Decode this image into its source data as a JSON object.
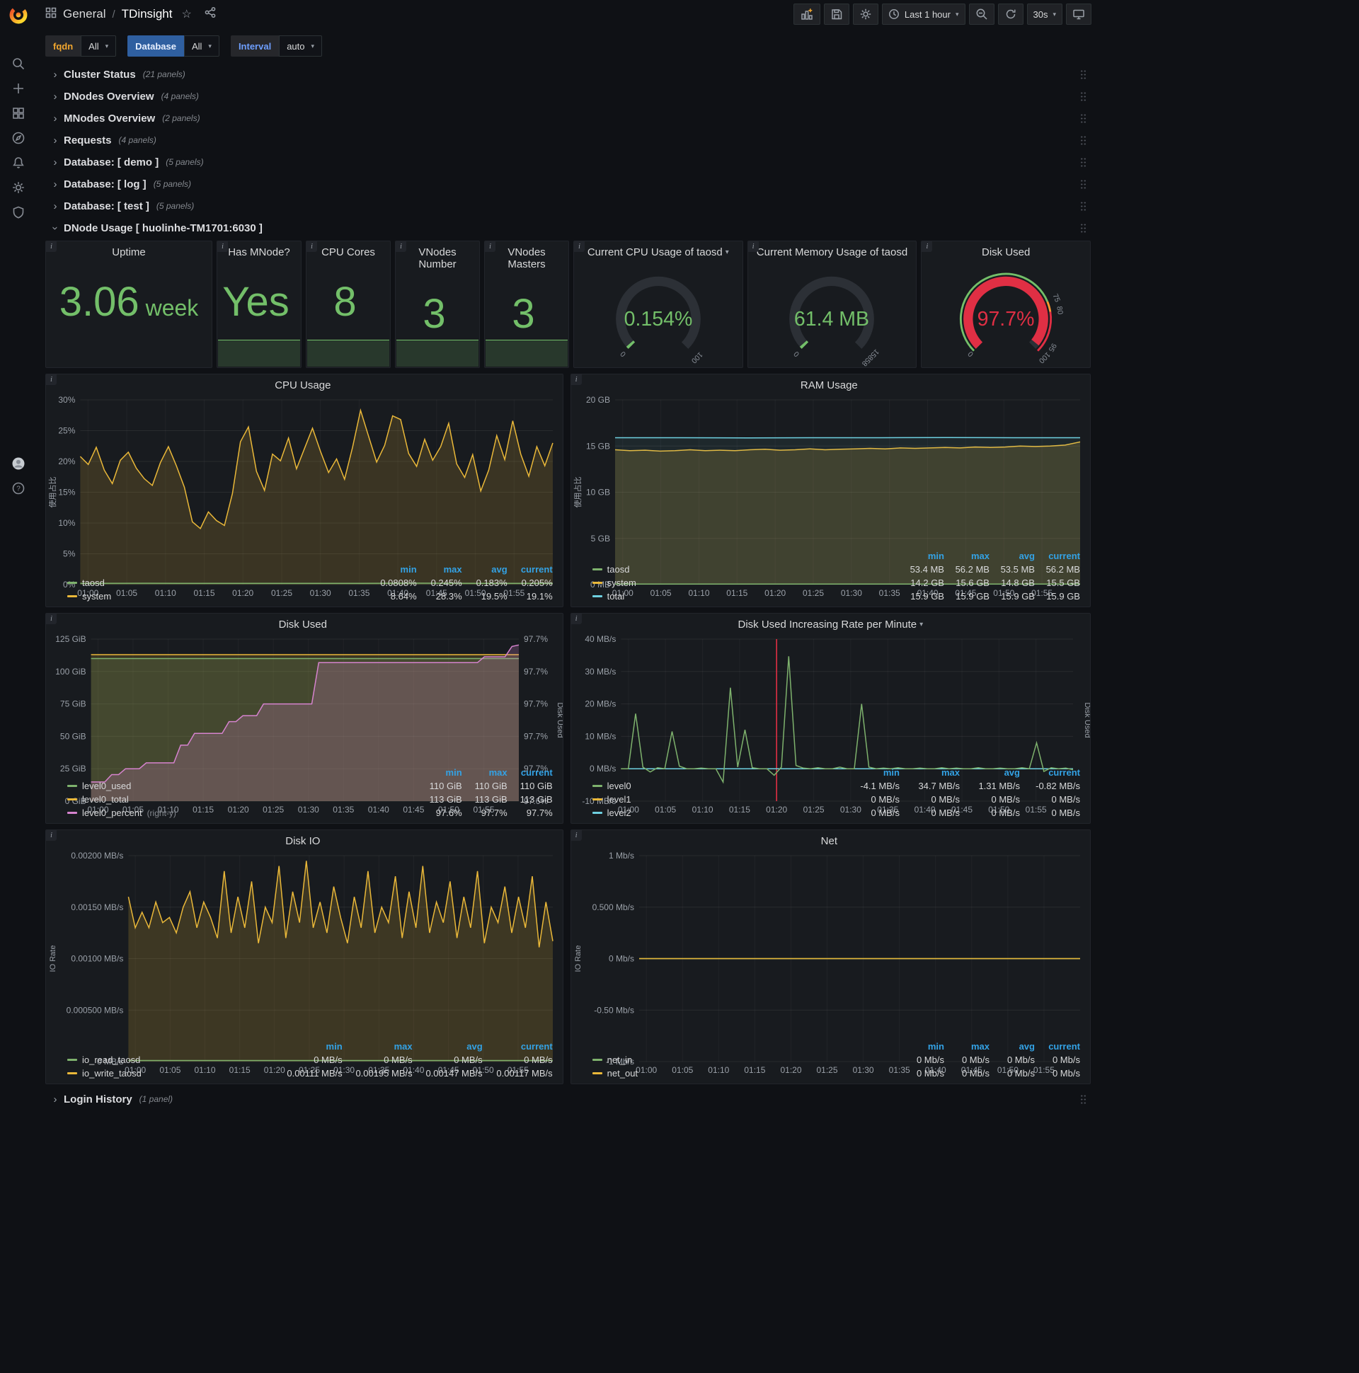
{
  "nav": {
    "section": "General",
    "separator": "/",
    "title": "TDinsight",
    "time_range": "Last 1 hour",
    "refresh": "30s"
  },
  "variables": [
    {
      "label": "fqdn",
      "value": "All",
      "label_color": "#f3a72e",
      "label_bg": "#26272b"
    },
    {
      "label": "Database",
      "value": "All",
      "label_color": "#e8f0ff",
      "label_bg": "#2f5fa0"
    },
    {
      "label": "Interval",
      "value": "auto",
      "label_color": "#6e9fff",
      "label_bg": "#26272b"
    }
  ],
  "rows_top": [
    {
      "title": "Cluster Status",
      "count": "(21 panels)"
    },
    {
      "title": "DNodes Overview",
      "count": "(4 panels)"
    },
    {
      "title": "MNodes Overview",
      "count": "(2 panels)"
    },
    {
      "title": "Requests",
      "count": "(4 panels)"
    },
    {
      "title": "Database: [ demo ]",
      "count": "(5 panels)"
    },
    {
      "title": "Database: [ log ]",
      "count": "(5 panels)"
    },
    {
      "title": "Database: [ test ]",
      "count": "(5 panels)"
    }
  ],
  "expanded_row": {
    "title": "DNode Usage [ huolinhe-TM1701:6030 ]"
  },
  "bottom_row": {
    "title": "Login History",
    "count": "(1 panel)"
  },
  "stats": [
    {
      "title": "Uptime",
      "value": "3.06",
      "unit": "week",
      "sparkline": false
    },
    {
      "title": "Has MNode?",
      "value": "Yes",
      "unit": "",
      "sparkline": true
    },
    {
      "title": "CPU Cores",
      "value": "8",
      "unit": "",
      "sparkline": true
    },
    {
      "title": "VNodes Number",
      "value": "3",
      "unit": "",
      "sparkline": true
    },
    {
      "title": "VNodes Masters",
      "value": "3",
      "unit": "",
      "sparkline": true
    }
  ],
  "gauges": [
    {
      "title": "Current CPU Usage of taosd",
      "menu_caret": "▾",
      "value": "0.154%",
      "min_label": "0",
      "max_label": "100",
      "fraction": 0.00154,
      "value_color": "#73bf69",
      "arc_color": "#73bf69",
      "thresholds": [],
      "ring": []
    },
    {
      "title": "Current Memory Usage of taosd",
      "menu_caret": "",
      "value": "61.4 MB",
      "min_label": "0",
      "max_label": "15858",
      "fraction": 0.004,
      "value_color": "#73bf69",
      "arc_color": "#73bf69",
      "thresholds": [],
      "ring": []
    },
    {
      "title": "Disk Used",
      "menu_caret": "",
      "value": "97.7%",
      "min_label": "0",
      "max_label": "100",
      "fraction": 0.977,
      "value_color": "#e02f44",
      "arc_color": "#e02f44",
      "thresholds": [
        {
          "frac": 0.75,
          "label": "75"
        },
        {
          "frac": 0.8,
          "label": "80"
        },
        {
          "frac": 0.95,
          "label": "95"
        }
      ],
      "ring": [
        {
          "from": 0,
          "to": 0.75,
          "color": "#73bf69"
        },
        {
          "from": 0.75,
          "to": 0.8,
          "color": "#ff9830"
        },
        {
          "from": 0.8,
          "to": 1,
          "color": "#e02f44"
        }
      ]
    }
  ],
  "charts": [
    {
      "title": "CPU Usage",
      "menu_caret": "",
      "type": "line",
      "y_label": "使用占比",
      "y_ticks": [
        "30%",
        "25%",
        "20%",
        "15%",
        "10%",
        "5%",
        "0%"
      ],
      "y_range": [
        0,
        30
      ],
      "x_ticks": [
        "01:00",
        "01:05",
        "01:10",
        "01:15",
        "01:20",
        "01:25",
        "01:30",
        "01:35",
        "01:40",
        "01:45",
        "01:50",
        "01:55"
      ],
      "x_range": [
        -1,
        60
      ],
      "series": [
        {
          "name": "system",
          "color": "#eab839",
          "fill": 0.16,
          "values": [
            20.8,
            19.5,
            22.3,
            18.6,
            16.4,
            20.2,
            21.5,
            18.9,
            17.2,
            16.1,
            19.8,
            22.4,
            19.3,
            15.8,
            10.2,
            9.1,
            11.8,
            10.4,
            9.6,
            14.8,
            23.2,
            25.6,
            18.4,
            15.3,
            21.2,
            20.1,
            23.8,
            18.8,
            22.1,
            25.4,
            21.6,
            18.2,
            20.4,
            17.1,
            22.3,
            28.3,
            24.1,
            19.9,
            22.6,
            27.4,
            26.8,
            21.3,
            19.2,
            23.6,
            20.2,
            22.4,
            26.2,
            19.6,
            17.4,
            21.1,
            15.2,
            18.6,
            24.2,
            20.3,
            26.6,
            21.2,
            17.6,
            22.4,
            19.3,
            23.0
          ]
        },
        {
          "name": "taosd",
          "color": "#7eb26d",
          "fill": 0.12,
          "values": [
            0.2,
            0.22,
            0.19,
            0.21,
            0.2,
            0.23,
            0.2,
            0.21
          ]
        }
      ],
      "legend": {
        "cols": [
          "min",
          "max",
          "avg",
          "current"
        ],
        "rows": [
          {
            "name": "taosd",
            "color": "#7eb26d",
            "values": [
              "0.0808%",
              "0.245%",
              "0.183%",
              "0.205%"
            ]
          },
          {
            "name": "system",
            "color": "#eab839",
            "values": [
              "8.64%",
              "28.3%",
              "19.5%",
              "19.1%"
            ]
          }
        ]
      }
    },
    {
      "title": "RAM Usage",
      "menu_caret": "",
      "type": "line",
      "y_label": "使用占比",
      "y_ticks": [
        "20 GB",
        "15 GB",
        "10 GB",
        "5 GB",
        "0 MB"
      ],
      "y_range": [
        0,
        20
      ],
      "x_ticks": [
        "01:00",
        "01:05",
        "01:10",
        "01:15",
        "01:20",
        "01:25",
        "01:30",
        "01:35",
        "01:40",
        "01:45",
        "01:50",
        "01:55"
      ],
      "x_range": [
        -1,
        60
      ],
      "series": [
        {
          "name": "system",
          "color": "#eab839",
          "fill": 0.18,
          "values": [
            14.6,
            14.5,
            14.55,
            14.45,
            14.5,
            14.6,
            14.5,
            14.55,
            14.5,
            14.6,
            14.65,
            14.55,
            14.6,
            14.7,
            14.6,
            14.65,
            14.7,
            14.75,
            14.7,
            14.8,
            14.75,
            14.8,
            14.85,
            14.8,
            14.9,
            14.85,
            14.9,
            15.0,
            14.95,
            15.0,
            15.1,
            15.45
          ]
        },
        {
          "name": "total",
          "color": "#6ed0e0",
          "fill": 0.07,
          "values": [
            15.9,
            15.9,
            15.88,
            15.9,
            15.9,
            15.92,
            15.9,
            15.9
          ]
        },
        {
          "name": "taosd",
          "color": "#7eb26d",
          "fill": 0.1,
          "values": [
            0.052,
            0.052
          ]
        }
      ],
      "legend": {
        "cols": [
          "min",
          "max",
          "avg",
          "current"
        ],
        "rows": [
          {
            "name": "taosd",
            "color": "#7eb26d",
            "values": [
              "53.4 MB",
              "56.2 MB",
              "53.5 MB",
              "56.2 MB"
            ]
          },
          {
            "name": "system",
            "color": "#eab839",
            "values": [
              "14.2 GB",
              "15.6 GB",
              "14.8 GB",
              "15.5 GB"
            ]
          },
          {
            "name": "total",
            "color": "#6ed0e0",
            "values": [
              "15.9 GB",
              "15.9 GB",
              "15.9 GB",
              "15.9 GB"
            ]
          }
        ]
      }
    },
    {
      "title": "Disk Used",
      "menu_caret": "",
      "type": "line",
      "y_ticks": [
        "125 GiB",
        "100 GiB",
        "75 GiB",
        "50 GiB",
        "25 GiB",
        "0 GiB"
      ],
      "y_range": [
        0,
        125
      ],
      "y2_ticks": [
        "97.7%",
        "97.7%",
        "97.7%",
        "97.7%",
        "97.7%",
        "97.6%"
      ],
      "y2_range": [
        97.595,
        97.705
      ],
      "y2_label": "Disk Used",
      "x_ticks": [
        "01:00",
        "01:05",
        "01:10",
        "01:15",
        "01:20",
        "01:25",
        "01:30",
        "01:35",
        "01:40",
        "01:45",
        "01:50",
        "01:55"
      ],
      "x_range": [
        -1,
        60
      ],
      "series": [
        {
          "name": "level0_total",
          "color": "#eab839",
          "fill": 0.16,
          "values": [
            113,
            113
          ]
        },
        {
          "name": "level0_used",
          "color": "#7eb26d",
          "fill": 0.16,
          "values": [
            110,
            110
          ]
        },
        {
          "name": "level0_percent",
          "color": "#d683ce",
          "fill": 0.22,
          "y2": true,
          "values": [
            97.608,
            97.608,
            97.608,
            97.613,
            97.613,
            97.617,
            97.617,
            97.617,
            97.621,
            97.621,
            97.621,
            97.621,
            97.621,
            97.633,
            97.633,
            97.641,
            97.641,
            97.641,
            97.641,
            97.641,
            97.649,
            97.649,
            97.653,
            97.653,
            97.653,
            97.661,
            97.661,
            97.661,
            97.661,
            97.661,
            97.661,
            97.661,
            97.661,
            97.689,
            97.689,
            97.689,
            97.689,
            97.689,
            97.689,
            97.689,
            97.689,
            97.689,
            97.689,
            97.689,
            97.689,
            97.689,
            97.689,
            97.689,
            97.689,
            97.689,
            97.689,
            97.689,
            97.689,
            97.689,
            97.689,
            97.689,
            97.689,
            97.693,
            97.693,
            97.693,
            97.693,
            97.7,
            97.701
          ]
        }
      ],
      "legend": {
        "cols": [
          "min",
          "max",
          "current"
        ],
        "rows": [
          {
            "name": "level0_used",
            "color": "#7eb26d",
            "values": [
              "110 GiB",
              "110 GiB",
              "110 GiB"
            ]
          },
          {
            "name": "level0_total",
            "color": "#eab839",
            "values": [
              "113 GiB",
              "113 GiB",
              "113 GiB"
            ]
          },
          {
            "name": "level0_percent",
            "suffix": "(right-y)",
            "color": "#d683ce",
            "values": [
              "97.6%",
              "97.7%",
              "97.7%"
            ]
          }
        ]
      }
    },
    {
      "title": "Disk Used Increasing Rate per Minute",
      "menu_caret": "▾",
      "type": "line",
      "y_ticks": [
        "40 MB/s",
        "30 MB/s",
        "20 MB/s",
        "10 MB/s",
        "0 MB/s",
        "-10 MB/s"
      ],
      "y_range": [
        -10,
        40
      ],
      "y2_label": "Disk Used",
      "x_ticks": [
        "01:00",
        "01:05",
        "01:10",
        "01:15",
        "01:20",
        "01:25",
        "01:30",
        "01:35",
        "01:40",
        "01:45",
        "01:50",
        "01:55"
      ],
      "x_range": [
        -1,
        60
      ],
      "annotation": {
        "x": 20,
        "color": "#e02f44"
      },
      "series": [
        {
          "name": "level1",
          "color": "#eab839",
          "fill": 0,
          "values": [
            0,
            0
          ]
        },
        {
          "name": "level2",
          "color": "#6ed0e0",
          "fill": 0,
          "values": [
            0,
            0
          ]
        },
        {
          "name": "level0",
          "color": "#7eb26d",
          "fill": 0,
          "values": [
            0,
            0,
            17,
            0.5,
            -1,
            0.3,
            0,
            11.5,
            0.8,
            0,
            0,
            0.2,
            0,
            0,
            -4.1,
            25,
            0.5,
            12,
            0.3,
            0,
            0,
            -2,
            0.5,
            34.7,
            1,
            0.2,
            0,
            0.3,
            0,
            0,
            0.5,
            0,
            0,
            20,
            0.5,
            0,
            0.2,
            0,
            0.3,
            0,
            0,
            0.2,
            0,
            0,
            0.3,
            0,
            0.2,
            0,
            0,
            0.3,
            0,
            0,
            0.2,
            0,
            0,
            0.3,
            0,
            8,
            -0.82,
            0.3,
            0,
            0.2,
            -0.3
          ]
        }
      ],
      "legend": {
        "cols": [
          "min",
          "max",
          "avg",
          "current"
        ],
        "rows": [
          {
            "name": "level0",
            "color": "#7eb26d",
            "values": [
              "-4.1 MB/s",
              "34.7 MB/s",
              "1.31 MB/s",
              "-0.82 MB/s"
            ]
          },
          {
            "name": "level1",
            "color": "#eab839",
            "values": [
              "0 MB/s",
              "0 MB/s",
              "0 MB/s",
              "0 MB/s"
            ]
          },
          {
            "name": "level2",
            "color": "#6ed0e0",
            "values": [
              "0 MB/s",
              "0 MB/s",
              "0 MB/s",
              "0 MB/s"
            ]
          }
        ]
      }
    },
    {
      "title": "Disk IO",
      "menu_caret": "",
      "type": "line",
      "y_label": "IO Rate",
      "y_ticks": [
        "0.00200 MB/s",
        "0.00150 MB/s",
        "0.00100 MB/s",
        "0.000500 MB/s",
        "0 MB/s"
      ],
      "y_range": [
        0,
        0.002
      ],
      "x_ticks": [
        "01:00",
        "01:05",
        "01:10",
        "01:15",
        "01:20",
        "01:25",
        "01:30",
        "01:35",
        "01:40",
        "01:45",
        "01:50",
        "01:55"
      ],
      "x_range": [
        -1,
        60
      ],
      "series": [
        {
          "name": "io_write_taosd",
          "color": "#eab839",
          "fill": 0.18,
          "values": [
            0.0016,
            0.0013,
            0.00145,
            0.0013,
            0.00155,
            0.00135,
            0.0014,
            0.00125,
            0.0015,
            0.00165,
            0.0013,
            0.00155,
            0.0014,
            0.0012,
            0.00185,
            0.00125,
            0.0016,
            0.0013,
            0.00175,
            0.00115,
            0.0015,
            0.00135,
            0.0019,
            0.0012,
            0.00165,
            0.00135,
            0.00195,
            0.0013,
            0.00155,
            0.00125,
            0.0017,
            0.0014,
            0.00115,
            0.0016,
            0.0013,
            0.00185,
            0.00125,
            0.0015,
            0.00135,
            0.0018,
            0.0012,
            0.00165,
            0.0013,
            0.0019,
            0.00125,
            0.00155,
            0.00135,
            0.00175,
            0.0012,
            0.0016,
            0.0013,
            0.00185,
            0.00115,
            0.0015,
            0.00135,
            0.0017,
            0.00125,
            0.0016,
            0.0013,
            0.0018,
            0.00111,
            0.00155,
            0.00117
          ]
        },
        {
          "name": "io_read_taosd",
          "color": "#7eb26d",
          "fill": 0,
          "values": [
            1e-05,
            1e-05
          ]
        }
      ],
      "legend": {
        "cols": [
          "min",
          "max",
          "avg",
          "current"
        ],
        "rows": [
          {
            "name": "io_read_taosd",
            "color": "#7eb26d",
            "values": [
              "0 MB/s",
              "0 MB/s",
              "0 MB/s",
              "0 MB/s"
            ]
          },
          {
            "name": "io_write_taosd",
            "color": "#eab839",
            "values": [
              "0.00111 MB/s",
              "0.00195 MB/s",
              "0.00147 MB/s",
              "0.00117 MB/s"
            ]
          }
        ]
      }
    },
    {
      "title": "Net",
      "menu_caret": "",
      "type": "line",
      "y_label": "IO Rate",
      "y_ticks": [
        "1 Mb/s",
        "0.500 Mb/s",
        "0 Mb/s",
        "-0.50 Mb/s",
        "-1 Mb/s"
      ],
      "y_range": [
        -1,
        1
      ],
      "x_ticks": [
        "01:00",
        "01:05",
        "01:10",
        "01:15",
        "01:20",
        "01:25",
        "01:30",
        "01:35",
        "01:40",
        "01:45",
        "01:50",
        "01:55"
      ],
      "x_range": [
        -1,
        60
      ],
      "series": [
        {
          "name": "net_in",
          "color": "#7eb26d",
          "fill": 0,
          "values": [
            0,
            0
          ]
        },
        {
          "name": "net_out",
          "color": "#eab839",
          "fill": 0,
          "values": [
            0,
            0
          ]
        }
      ],
      "legend": {
        "cols": [
          "min",
          "max",
          "avg",
          "current"
        ],
        "rows": [
          {
            "name": "net_in",
            "color": "#7eb26d",
            "values": [
              "0 Mb/s",
              "0 Mb/s",
              "0 Mb/s",
              "0 Mb/s"
            ]
          },
          {
            "name": "net_out",
            "color": "#eab839",
            "values": [
              "0 Mb/s",
              "0 Mb/s",
              "0 Mb/s",
              "0 Mb/s"
            ]
          }
        ]
      }
    }
  ]
}
